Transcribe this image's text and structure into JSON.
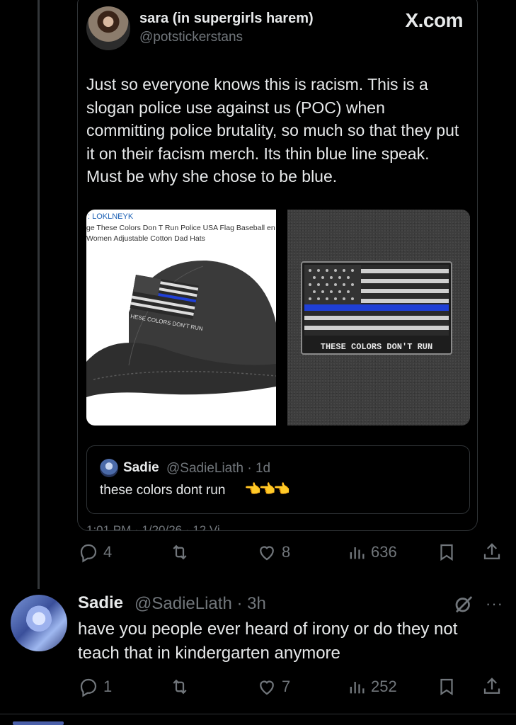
{
  "quoted_card": {
    "author_name": "sara (in supergirls harem)",
    "author_handle": "@potstickerstans",
    "brand": "X.com",
    "text": "Just so everyone knows this is racism. This is a slogan police use against us (POC) when committing police brutality, so much so that they put it on their facism merch. Its thin blue line speak. Must be why she chose to be blue.",
    "media": {
      "store_brand": ": LOKLNEYK",
      "store_title": "ge These Colors Don T Run Police USA Flag Baseball en Women Adjustable Cotton Dad Hats",
      "hat_print": "HESE COLORS DON'T RUN",
      "patch_text": "THESE COLORS DON'T RUN"
    },
    "quoted_tweet": {
      "name": "Sadie",
      "handle": "@SadieLiath · 1d",
      "text": "these colors dont run",
      "emoji": "👈👈👈"
    },
    "meta": "1:01 PM · 1/20/26 · 12 Vi"
  },
  "card_actions": {
    "replies": "4",
    "reposts": "",
    "likes": "8",
    "views": "636"
  },
  "reply": {
    "name": "Sadie",
    "handle": "@SadieLiath · 3h",
    "text": "have you people ever heard of irony or do they not teach that in kindergarten anymore",
    "more": "···"
  },
  "reply_actions": {
    "replies": "1",
    "reposts": "",
    "likes": "7",
    "views": "252"
  },
  "colors": {
    "background": "#000000",
    "text_primary": "#e7e9ea",
    "text_secondary": "#71767b",
    "border": "#2f3336",
    "thin_blue_line": "#1f3fd6"
  }
}
